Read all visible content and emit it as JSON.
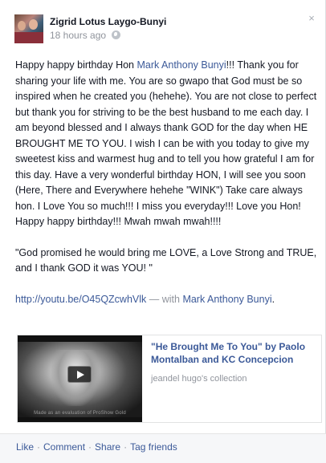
{
  "post": {
    "author": "Zigrid Lotus Laygo-Bunyi",
    "timestamp": "18 hours ago",
    "privacy_icon": "globe-icon",
    "close_glyph": "×",
    "message": {
      "p1_before": "Happy happy birthday Hon ",
      "p1_tag": "Mark Anthony Bunyi",
      "p1_after": "!!! Thank you for sharing your life with me. You are so gwapo that God must be so inspired when he created you (hehehe). You are not close to perfect but thank you for striving to be the best husband to me each day. I am beyond blessed and I always thank GOD for the day when HE BROUGHT ME TO YOU. I wish I can be with you today to give my sweetest kiss and warmest hug and to tell you how grateful I am for this day. Have a very wonderful birthday HON, I will see you soon (Here, There and Everywhere hehehe \"WINK\") Take care always hon. I Love You so much!!! I miss you everyday!!! Love you Hon! Happy happy birthday!!! Mwah mwah mwah!!!!",
      "p2": "\"God promised he would bring me LOVE, a Love Strong and TRUE, and I thank GOD it was YOU! \"",
      "link_url": "http://youtu.be/O45QZcwhVlk",
      "with_text": " — with ",
      "with_tag": "Mark Anthony Bunyi",
      "with_end": "."
    },
    "attachment": {
      "title": "\"He Brought Me To You\" by Paolo Montalban and KC Concepcion",
      "source": "jeandel hugo's collection",
      "watermark": "Made as an evaluation of ProShow Gold"
    },
    "actions": {
      "like": "Like",
      "comment": "Comment",
      "share": "Share",
      "tag": "Tag friends",
      "separator": "·"
    }
  },
  "colors": {
    "link": "#3b5998",
    "text": "#141823",
    "meta": "#90949c"
  }
}
